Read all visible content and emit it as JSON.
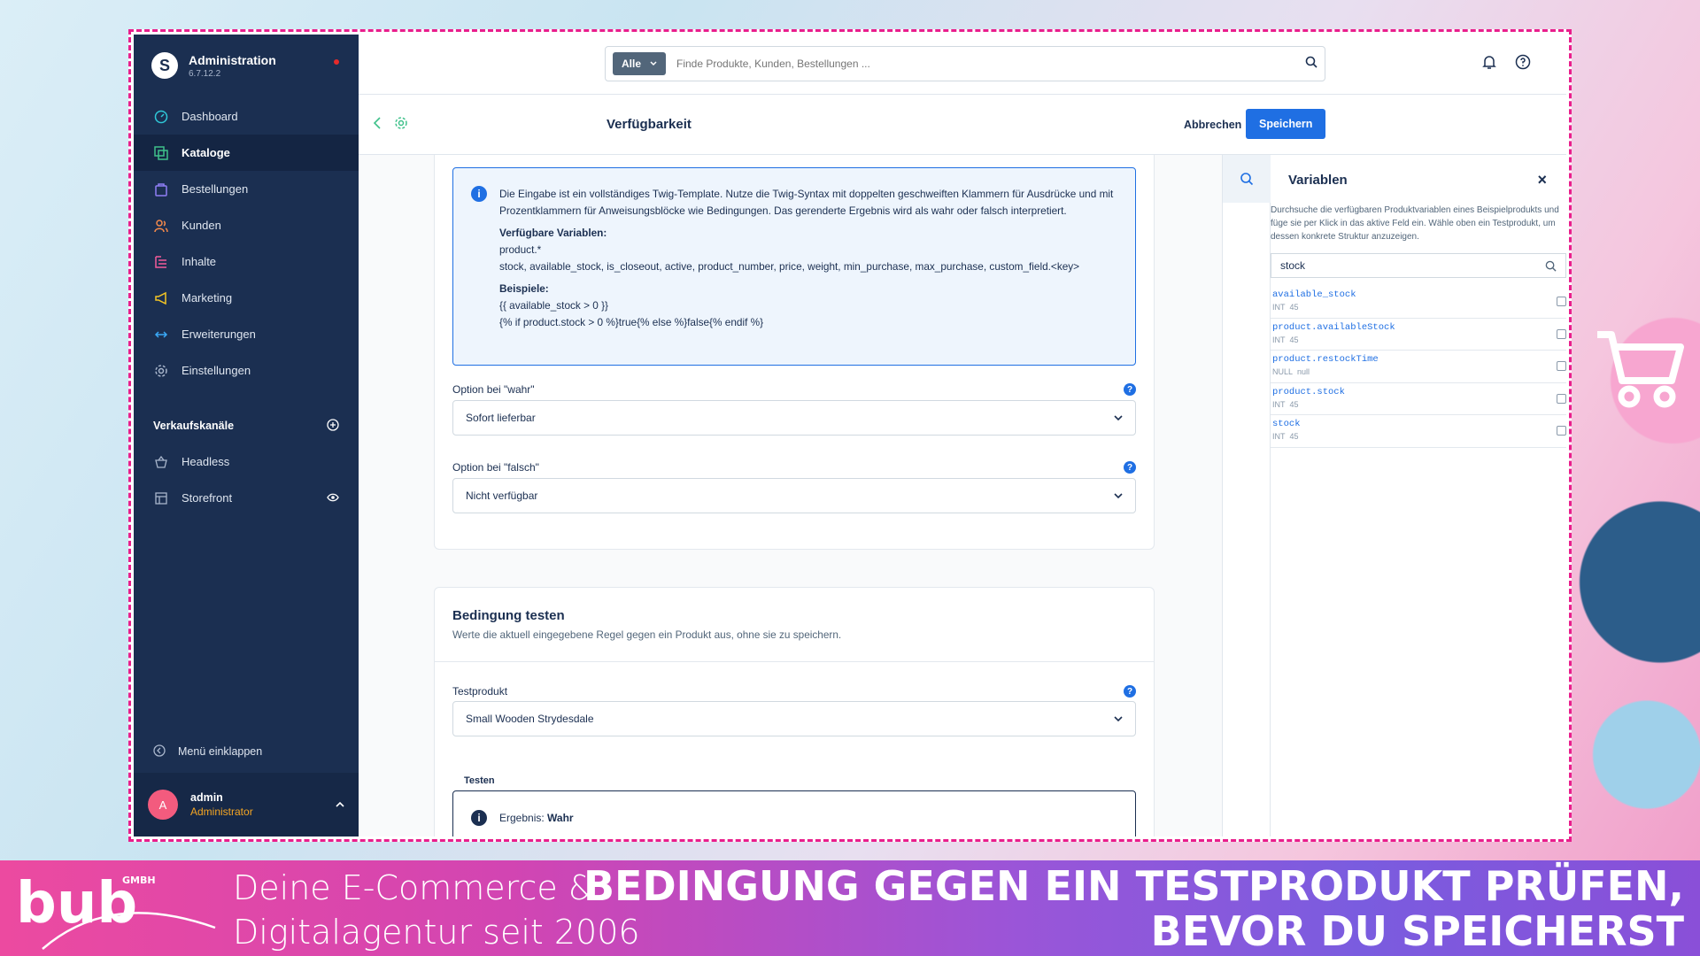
{
  "app": {
    "title": "Administration",
    "version": "6.7.12.2"
  },
  "nav": [
    {
      "label": "Dashboard",
      "icon": "dashboard-icon",
      "active": false
    },
    {
      "label": "Kataloge",
      "icon": "catalog-icon",
      "active": true
    },
    {
      "label": "Bestellungen",
      "icon": "orders-icon",
      "active": false
    },
    {
      "label": "Kunden",
      "icon": "customers-icon",
      "active": false
    },
    {
      "label": "Inhalte",
      "icon": "content-icon",
      "active": false
    },
    {
      "label": "Marketing",
      "icon": "megaphone-icon",
      "active": false
    },
    {
      "label": "Erweiterungen",
      "icon": "extensions-icon",
      "active": false
    },
    {
      "label": "Einstellungen",
      "icon": "gear-icon",
      "active": false
    }
  ],
  "channels": {
    "title": "Verkaufskanäle",
    "items": [
      {
        "label": "Headless"
      },
      {
        "label": "Storefront"
      }
    ]
  },
  "collapse_label": "Menü einklappen",
  "user": {
    "initial": "A",
    "name": "admin",
    "role": "Administrator"
  },
  "search": {
    "filter": "Alle",
    "placeholder": "Finde Produkte, Kunden, Bestellungen ..."
  },
  "page": {
    "title": "Verfügbarkeit",
    "cancel": "Abbrechen",
    "save": "Speichern"
  },
  "info": {
    "text": "Die Eingabe ist ein vollständiges Twig-Template. Nutze die Twig-Syntax mit doppelten geschweiften Klammern für Ausdrücke und mit Prozentklammern für Anweisungsblöcke wie Bedingungen. Das gerenderte Ergebnis wird als wahr oder falsch interpretiert.",
    "vars_title": "Verfügbare Variablen:",
    "vars_line1": "product.*",
    "vars_line2": "stock, available_stock, is_closeout, active, product_number, price, weight, min_purchase, max_purchase, custom_field.<key>",
    "examples_title": "Beispiele:",
    "example1": "{{ available_stock > 0 }}",
    "example2": "{% if product.stock > 0 %}true{% else %}false{% endif %}"
  },
  "option_true": {
    "label": "Option bei \"wahr\"",
    "value": "Sofort lieferbar"
  },
  "option_false": {
    "label": "Option bei \"falsch\"",
    "value": "Nicht verfügbar"
  },
  "test": {
    "title": "Bedingung testen",
    "description": "Werte die aktuell eingegebene Regel gegen ein Produkt aus, ohne sie zu speichern.",
    "product_label": "Testprodukt",
    "product_value": "Small Wooden Strydesdale",
    "test_label": "Testen",
    "result_prefix": "Ergebnis:",
    "result_value": "Wahr"
  },
  "variables": {
    "title": "Variablen",
    "description": "Durchsuche die verfügbaren Produktvariablen eines Beispielprodukts und füge sie per Klick in das aktive Feld ein. Wähle oben ein Testprodukt, um dessen konkrete Struktur anzuzeigen.",
    "search_value": "stock",
    "items": [
      {
        "name": "available_stock",
        "type": "INT",
        "value": "45"
      },
      {
        "name": "product.availableStock",
        "type": "INT",
        "value": "45"
      },
      {
        "name": "product.restockTime",
        "type": "NULL",
        "value": "null"
      },
      {
        "name": "product.stock",
        "type": "INT",
        "value": "45"
      },
      {
        "name": "stock",
        "type": "INT",
        "value": "45"
      }
    ]
  },
  "banner": {
    "slogan_line1": "Deine E-Commerce &",
    "slogan_line2": "Digitalagentur seit 2006",
    "headline_line1": "BEDINGUNG GEGEN EIN TESTPRODUKT PRÜFEN,",
    "headline_line2": "BEVOR DU SPEICHERST",
    "logo_text": "bub",
    "logo_sub": "GMBH"
  },
  "colors": {
    "accent": "#1f6fe3",
    "sidebar": "#1b2f51",
    "frame": "#e91e8c",
    "role": "#f5a623"
  }
}
